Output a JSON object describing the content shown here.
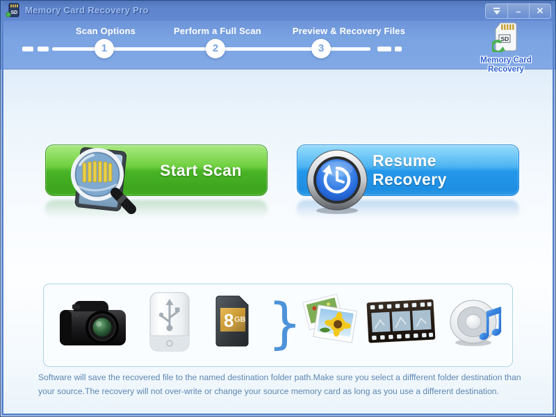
{
  "window": {
    "title": "Memory Card Recovery Pro",
    "controls": {
      "rollup_icon": "triangle-down-with-bar",
      "minimize_glyph": "–",
      "close_glyph": "✕"
    }
  },
  "wizard": {
    "steps": [
      {
        "number": "1",
        "label": "Scan Options"
      },
      {
        "number": "2",
        "label": "Perform a Full Scan"
      },
      {
        "number": "3",
        "label": "Preview & Recovery Files"
      }
    ]
  },
  "logo": {
    "line1": "Memory Card",
    "line2": "Recovery",
    "sd_label": "SD"
  },
  "actions": {
    "start_scan": "Start Scan",
    "resume_recovery": "Resume Recovery"
  },
  "media_panel": {
    "sd_capacity": "8",
    "sd_unit": "GB",
    "brace": "}",
    "icons": [
      "camera-icon",
      "usb-drive-icon",
      "sd-card-icon",
      "curly-brace",
      "photos-icon",
      "film-strip-icon",
      "speaker-icon"
    ]
  },
  "footer": {
    "text": "Software will save the recovered file to the named destination folder path.Make sure you select a diffferent folder destination than your source.The recovery will not over-write or change your source memory card as long as you use a different destination."
  },
  "colors": {
    "titlebar_blue": "#6189d2",
    "band_blue": "#7da4e2",
    "button_green": "#49b427",
    "button_blue": "#2397ea",
    "logo_text": "#2c5fd0",
    "footer_text": "#5d86b2"
  }
}
